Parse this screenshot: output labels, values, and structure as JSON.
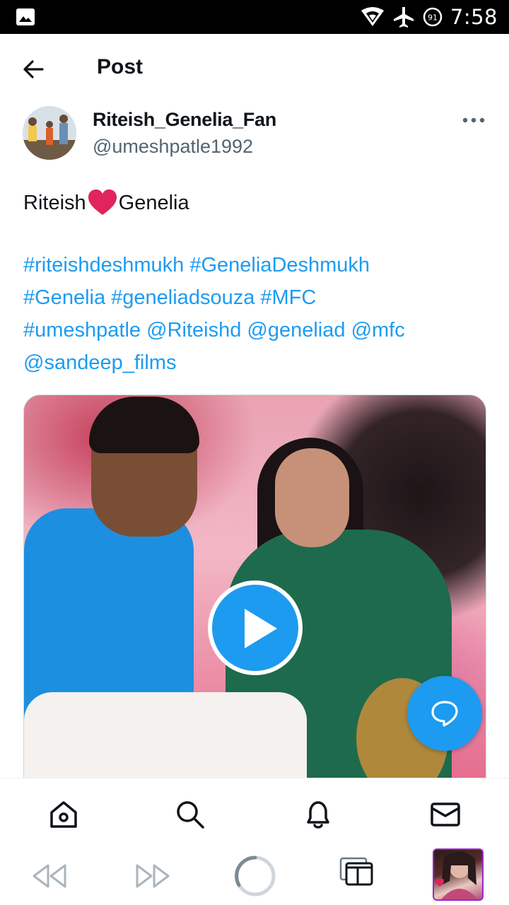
{
  "status_bar": {
    "time": "7:58",
    "battery": "91",
    "icons": [
      "image-icon",
      "wifi-icon",
      "airplane-icon",
      "battery-icon"
    ]
  },
  "header": {
    "title": "Post",
    "back_icon": "arrow-left-icon"
  },
  "author": {
    "display_name": "Riteish_Genelia_Fan",
    "handle": "@umeshpatle1992"
  },
  "post": {
    "text_before": "Riteish",
    "emoji": "heart",
    "text_after": "Genelia",
    "hashtag_lines": [
      [
        "#riteishdeshmukh",
        "#GeneliaDeshmukh"
      ],
      [
        "#Genelia",
        "#geneliadsouza",
        "#MFC"
      ],
      [
        "#umeshpatle",
        "@Riteishd",
        "@geneliad",
        "@mfc"
      ],
      [
        "@sandeep_films"
      ]
    ]
  },
  "media": {
    "type": "video",
    "play_icon": "play-icon"
  },
  "fab": {
    "icon": "reply-bubble-icon"
  },
  "tabbar": {
    "items": [
      "home-icon",
      "search-icon",
      "bell-icon",
      "mail-icon"
    ]
  },
  "browser_nav": {
    "items": [
      "rewind-icon",
      "fast-forward-icon",
      "reload-icon",
      "tabs-icon",
      "profile-thumbnail"
    ]
  },
  "colors": {
    "accent": "#1d9bf0",
    "text": "#0f1419",
    "secondary_text": "#536471",
    "heart": "#e0245e"
  }
}
